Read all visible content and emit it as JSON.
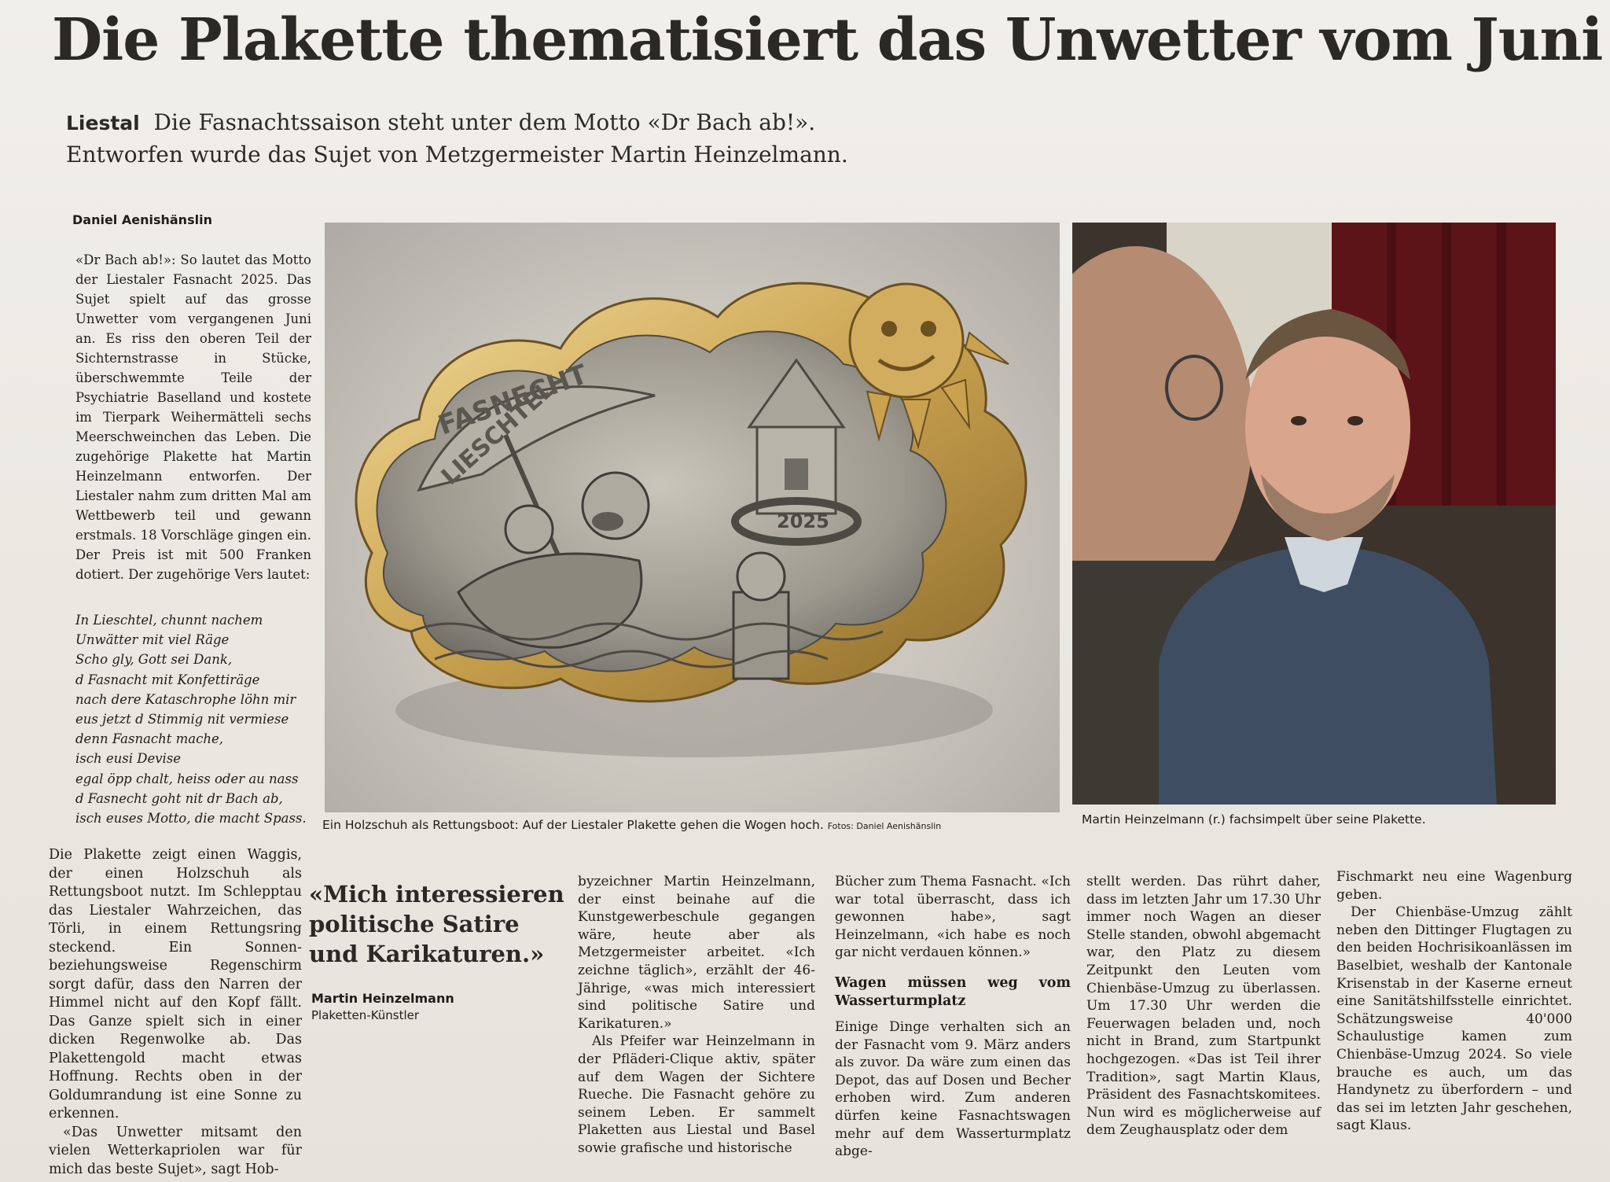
{
  "headline": "Die Plakette thematisiert das Unwetter vom Juni",
  "lead": {
    "location": "Liestal",
    "line1": "Die Fasnachtssaison steht unter dem Motto «Dr Bach ab!».",
    "line2": "Entworfen wurde das Sujet von Metzgermeister Martin Heinzelmann."
  },
  "byline": "Daniel Aenishänslin",
  "col1_text": "«Dr Bach ab!»: So lautet das Motto der Liestaler Fasnacht 2025. Das Sujet spielt auf das grosse Unwetter vom vergangenen Juni an. Es riss den oberen Teil der Sichternstrasse in Stücke, überschwemmte Teile der Psychiatrie Baselland und kostete im Tierpark Weihermätteli sechs Meerschweinchen das Leben. Die zugehörige Plakette hat Martin Heinzelmann entworfen. Der Liestaler nahm zum dritten Mal am Wettbewerb teil und gewann erstmals. 18 Vorschläge gingen ein. Der Preis ist mit 500 Franken dotiert. Der zugehörige Vers lautet:",
  "verse": [
    "In Lieschtel, chunnt nachem",
    "Unwätter mit viel Räge",
    "Scho gly, Gott sei Dank,",
    "d Fasnacht mit Konfettiräge",
    "nach dere Kataschrophe löhn mir",
    "eus jetzt d Stimmig nit vermiese",
    "denn Fasnacht mache,",
    "isch eusi Devise",
    "egal öpp chalt, heiss oder au nass",
    "d Fasnecht goht nit dr Bach ab,",
    "isch euses Motto, die macht Spass."
  ],
  "col1b_p1": "Die Plakette zeigt einen Waggis, der einen Holzschuh als Rettungsboot nutzt. Im Schlepptau das Liestaler Wahrzeichen, das Törli, in einem Rettungsring steckend. Ein Sonnen- beziehungsweise Regenschirm sorgt dafür, dass den Narren der Himmel nicht auf den Kopf fällt. Das Ganze spielt sich in einer dicken Regenwolke ab. Das Plakettengold macht etwas Hoffnung. Rechts oben in der Goldumrandung ist eine Sonne zu erkennen.",
  "col1b_p2": "«Das Unwetter mitsamt den vielen Wetterkapriolen war für mich das beste Sujet», sagt Hob-",
  "plaque": {
    "top_text": "FASNECHT",
    "banner_text": "LIESCHTEL",
    "year": "2025"
  },
  "caption1": "Ein Holzschuh als Rettungsboot: Auf der Liestaler Plakette gehen die Wogen hoch.",
  "credit1": "Fotos: Daniel Aenishänslin",
  "caption2": "Martin Heinzelmann (r.) fachsimpelt über seine Plakette.",
  "quote": "«Mich interessieren politische Satire und Karikaturen.»",
  "quote_name": "Martin Heinzelmann",
  "quote_role": "Plaketten-Künstler",
  "col3_p1": "byzeichner Martin Heinzelmann, der einst beinahe auf die Kunstgewerbeschule gegangen wäre, heute aber als Metzgermeister arbeitet. «Ich zeichne täglich», erzählt der 46-Jährige, «was mich interessiert sind politische Satire und Karikaturen.»",
  "col3_p2": "Als Pfeifer war Heinzelmann in der Pfläderi-Clique aktiv, später auf dem Wagen der Sichtere Rueche. Die Fasnacht gehöre zu seinem Leben. Er sammelt Plaketten aus Liestal und Basel sowie grafische und historische",
  "col4_p1": "Bücher zum Thema Fasnacht. «Ich war total überrascht, dass ich gewonnen habe», sagt Heinzelmann, «ich habe es noch gar nicht verdauen können.»",
  "col4_subhead": "Wagen müssen weg vom Wasserturmplatz",
  "col4_p2": "Einige Dinge verhalten sich an der Fasnacht vom 9. März anders als zuvor. Da wäre zum einen das Depot, das auf Dosen und Becher erhoben wird. Zum anderen dürfen keine Fasnachtswagen mehr auf dem Wasserturmplatz abge-",
  "col5_p1": "stellt werden. Das rührt daher, dass im letzten Jahr um 17.30 Uhr immer noch Wagen an dieser Stelle standen, obwohl abgemacht war, den Platz zu diesem Zeitpunkt den Leuten vom Chienbäse-Umzug zu überlassen. Um 17.30 Uhr werden die Feuerwagen beladen und, noch nicht in Brand, zum Startpunkt hochgezogen. «Das ist Teil ihrer Tradition», sagt Martin Klaus, Präsident des Fasnachtskomitees. Nun wird es möglicherweise auf dem Zeughausplatz oder dem",
  "col6_p1": "Fischmarkt neu eine Wagenburg geben.",
  "col6_p2": "Der Chienbäse-Umzug zählt neben den Dittinger Flugtagen zu den beiden Hochrisikoanlässen im Baselbiet, weshalb der Kantonale Krisenstab in der Kaserne erneut eine Sanitätshilfsstelle einrichtet. Schätzungsweise 40'000 Schaulustige kamen zum Chienbäse-Umzug 2024. So viele brauche es auch, um das Handynetz zu überfordern – und das sei im letzten Jahr geschehen, sagt Klaus."
}
